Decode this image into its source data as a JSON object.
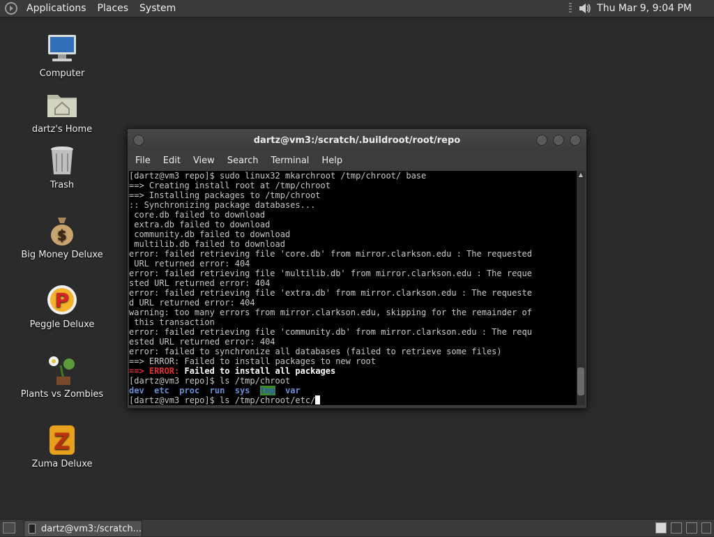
{
  "top_panel": {
    "menus": [
      "Applications",
      "Places",
      "System"
    ],
    "clock": "Thu Mar  9,  9:04 PM"
  },
  "desktop": {
    "icons": [
      {
        "label": "Computer"
      },
      {
        "label": "dartz's Home"
      },
      {
        "label": "Trash"
      },
      {
        "label": "Big Money Deluxe"
      },
      {
        "label": "Peggle Deluxe"
      },
      {
        "label": "Plants vs Zombies"
      },
      {
        "label": "Zuma Deluxe"
      }
    ]
  },
  "window": {
    "title": "dartz@vm3:/scratch/.buildroot/root/repo",
    "menu": [
      "File",
      "Edit",
      "View",
      "Search",
      "Terminal",
      "Help"
    ],
    "lines": [
      "[dartz@vm3 repo]$ sudo linux32 mkarchroot /tmp/chroot/ base",
      "==> Creating install root at /tmp/chroot",
      "==> Installing packages to /tmp/chroot",
      ":: Synchronizing package databases...",
      " core.db failed to download",
      " extra.db failed to download",
      " community.db failed to download",
      " multilib.db failed to download",
      "error: failed retrieving file 'core.db' from mirror.clarkson.edu : The requested",
      " URL returned error: 404",
      "error: failed retrieving file 'multilib.db' from mirror.clarkson.edu : The reque",
      "sted URL returned error: 404",
      "error: failed retrieving file 'extra.db' from mirror.clarkson.edu : The requeste",
      "d URL returned error: 404",
      "warning: too many errors from mirror.clarkson.edu, skipping for the remainder of",
      " this transaction",
      "error: failed retrieving file 'community.db' from mirror.clarkson.edu : The requ",
      "ested URL returned error: 404",
      "error: failed to synchronize all databases (failed to retrieve some files)",
      "==> ERROR: Failed to install packages to new root"
    ],
    "error_line": {
      "arrow": "==> ERROR:",
      "message": " Failed to install all packages"
    },
    "ls_command": "[dartz@vm3 repo]$ ls /tmp/chroot",
    "ls_entries": [
      "dev",
      "etc",
      "proc",
      "run",
      "sys",
      "tmp",
      "var"
    ],
    "prompt": "[dartz@vm3 repo]$ ls /tmp/chroot/etc/"
  },
  "taskbar": {
    "task_label": "dartz@vm3:/scratch..."
  }
}
